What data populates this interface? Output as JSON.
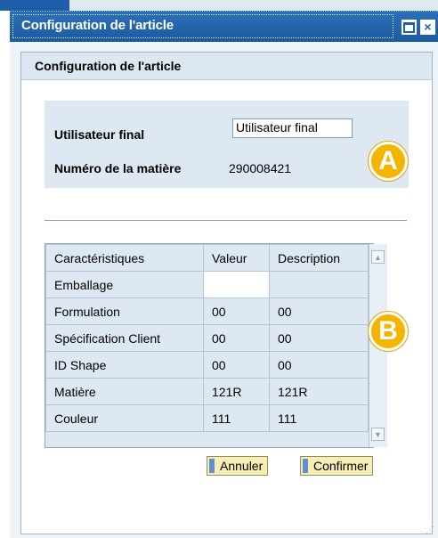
{
  "window": {
    "title": "Configuration de l'article",
    "maximize_icon": "maximize-icon",
    "close_icon": "close-icon",
    "close_glyph": "×"
  },
  "panel": {
    "title": "Configuration de l'article"
  },
  "form": {
    "user_label": "Utilisateur final",
    "user_value": "Utilisateur final",
    "material_label": "Numéro de la matière",
    "material_value": "290008421"
  },
  "table": {
    "headers": [
      "Caractéristiques",
      "Valeur",
      "Description"
    ],
    "rows": [
      [
        "Emballage",
        "",
        ""
      ],
      [
        "Formulation",
        "00",
        "00"
      ],
      [
        "Spécification Client",
        "00",
        "00"
      ],
      [
        "ID Shape",
        "00",
        "00"
      ],
      [
        "Matière",
        "121R",
        "121R"
      ],
      [
        "Couleur",
        "111",
        "111"
      ]
    ]
  },
  "buttons": {
    "cancel": "Annuler",
    "confirm": "Confirmer"
  },
  "badges": {
    "a": "A",
    "b": "B"
  },
  "colors": {
    "titlebar": "#1f5ea8",
    "badge": "#f5b400",
    "button_bg": "#f8edb4"
  }
}
